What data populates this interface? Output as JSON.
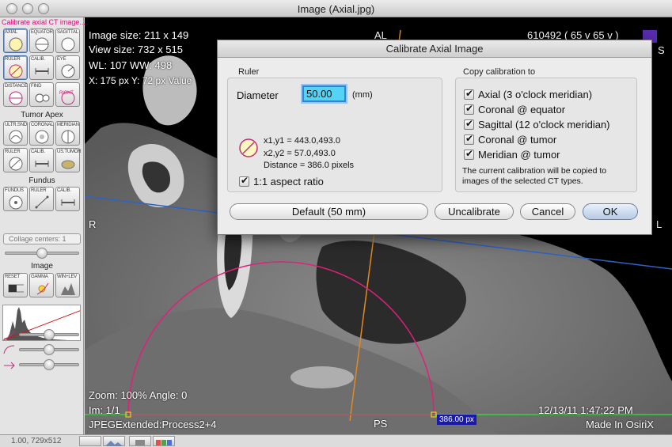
{
  "window": {
    "title": "Image (Axial.jpg)"
  },
  "palette": {
    "status_text": "Calibrate axial CT image...",
    "tools": [
      {
        "label": "AXIAL",
        "icon": "axial-circle-icon"
      },
      {
        "label": "EQUATOR",
        "icon": "equator-circle-icon"
      },
      {
        "label": "SAGITTAL",
        "icon": "sagittal-circle-icon"
      },
      {
        "label": "RULER",
        "icon": "ruler-icon"
      },
      {
        "label": "CALIB.",
        "icon": "calibration-icon"
      },
      {
        "label": "EYE",
        "icon": "eye-icon"
      },
      {
        "label": "DISTANCE",
        "icon": "distance-icon"
      },
      {
        "label": "FIND",
        "icon": "find-icon"
      },
      {
        "label": "RIGHT",
        "icon": "right-eye-icon"
      }
    ],
    "tumor_apex_label": "Tumor Apex",
    "tumor_tools": [
      {
        "label": "ULTR.SND",
        "icon": "ultrasound-icon"
      },
      {
        "label": "CORONAL",
        "icon": "coronal-icon"
      },
      {
        "label": "MERIDIAN",
        "icon": "meridian-icon"
      },
      {
        "label": "RULER",
        "icon": "ruler-icon"
      },
      {
        "label": "CALIB.",
        "icon": "calibration-icon"
      },
      {
        "label": "US.TUMOR",
        "icon": "us-tumor-icon"
      }
    ],
    "fundus_label": "Fundus",
    "fundus_tools": [
      {
        "label": "FUNDUS",
        "icon": "fundus-icon"
      },
      {
        "label": "RULER",
        "icon": "ruler-icon"
      },
      {
        "label": "CALIB.",
        "icon": "calibration-icon"
      }
    ],
    "collage_centers": "Collage centers: 1",
    "image_label": "Image",
    "image_tools": [
      {
        "label": "RESET",
        "icon": "reset-icon"
      },
      {
        "label": "GAMMA",
        "icon": "gamma-icon"
      },
      {
        "label": "WIN+LEV",
        "icon": "window-level-icon"
      }
    ],
    "collage_slider": 0.5,
    "sliders": [
      {
        "icon": "curve-low-icon",
        "value": 0.5
      },
      {
        "icon": "curve-high-icon",
        "value": 0.5
      },
      {
        "icon": "curve-invert-icon",
        "value": 0.5
      }
    ]
  },
  "viewer": {
    "image_size": "Image size: 211 x 149",
    "view_size": "View size: 732 x 515",
    "wl_ww": "WL: 107 WW: 498",
    "cursor": "X: 175 px Y: 72 px Value",
    "top_marker": "AL",
    "top_right": "610492 ( 65 v   65 v )",
    "right_marker_top": "S",
    "left_marker": "R",
    "right_marker": "L",
    "bottom_marker": "PS",
    "zoom": "Zoom: 100%  Angle: 0",
    "im": "Im: 1/1",
    "codec": "JPEGExtended:Process2+4",
    "datetime": "12/13/11 1:47:22 PM",
    "made_in": "Made In OsiriX",
    "measure_label": "386.00 px"
  },
  "bottom": {
    "coords": "1.00, 729x512"
  },
  "dialog": {
    "title": "Calibrate Axial Image",
    "ruler_group": "Ruler",
    "diameter_label": "Diameter",
    "diameter_value": "50.00",
    "unit": "(mm)",
    "p1": "x1,y1 = 443.0,493.0",
    "p2": "x2,y2 = 57.0,493.0",
    "distance": "Distance = 386.0 pixels",
    "aspect_label": "1:1 aspect ratio",
    "aspect_checked": true,
    "copy_group": "Copy calibration to",
    "copy_options": [
      {
        "label": "Axial (3 o'clock meridian)",
        "checked": true
      },
      {
        "label": "Coronal @ equator",
        "checked": true
      },
      {
        "label": "Sagittal (12 o'clock meridian)",
        "checked": true
      },
      {
        "label": "Coronal @ tumor",
        "checked": true
      },
      {
        "label": "Meridian @ tumor",
        "checked": true
      }
    ],
    "copy_note_line1": "The current calibration will be copied to",
    "copy_note_line2": "images of the selected CT types.",
    "buttons": {
      "default": "Default (50 mm)",
      "uncalibrate": "Uncalibrate",
      "cancel": "Cancel",
      "ok": "OK"
    }
  }
}
